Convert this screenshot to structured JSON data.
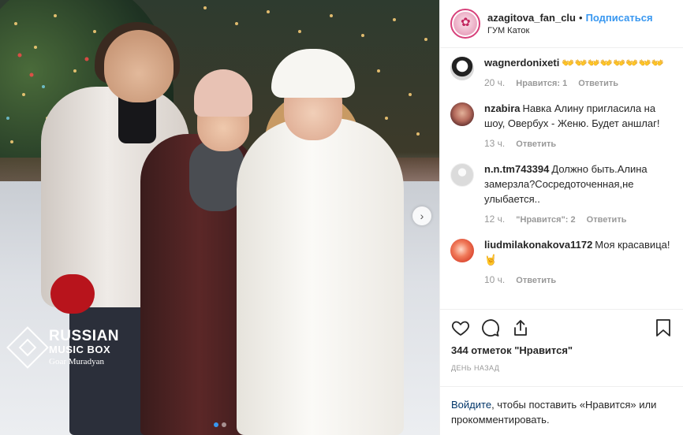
{
  "photo": {
    "watermark": {
      "line1": "RUSSIAN",
      "line2": "MUSIC BOX",
      "line3": "Goar Muradyan"
    },
    "next_icon": "chevron-right-icon",
    "carousel_total": 2,
    "carousel_active": 1
  },
  "header": {
    "username": "azagitova_fan_club",
    "separator": "•",
    "follow_label": "Подписаться",
    "location": "ГУМ Каток"
  },
  "comments": [
    {
      "username": "wagnerdonixeti",
      "text": "👐👐👐👐👐👐👐👐",
      "time": "20 ч.",
      "likes": "Нравится: 1",
      "reply": "Ответить",
      "avatar_color": "#d9d9d9"
    },
    {
      "username": "nzabira",
      "text": "Навка Алину пригласила на шоу, Овербух - Женю. Будет аншлаг!",
      "time": "13 ч.",
      "likes": "",
      "reply": "Ответить",
      "avatar_color": "#8a3a3a"
    },
    {
      "username": "n.n.tm743394",
      "text": "Должно быть.Алина замерзла?Сосредоточенная,не улыбается..",
      "time": "12 ч.",
      "likes": "\"Нравится\": 2",
      "reply": "Ответить",
      "avatar_color": "#dbdbdb"
    },
    {
      "username": "liudmilakonakova1172",
      "text": "Моя красавица!🤘",
      "time": "10 ч.",
      "likes": "",
      "reply": "Ответить",
      "avatar_color": "#e8553a"
    }
  ],
  "actions": {
    "like_icon": "heart-icon",
    "comment_icon": "comment-icon",
    "share_icon": "share-icon",
    "save_icon": "bookmark-icon",
    "likes_text": "344 отметок \"Нравится\"",
    "date_text": "ДЕНЬ НАЗАД"
  },
  "login_prompt": {
    "link": "Войдите",
    "text": ", чтобы поставить «Нравится» или прокомментировать."
  },
  "colors": {
    "accent": "#3897f0",
    "link_dark": "#003569",
    "muted": "#999999",
    "border": "#efefef"
  }
}
